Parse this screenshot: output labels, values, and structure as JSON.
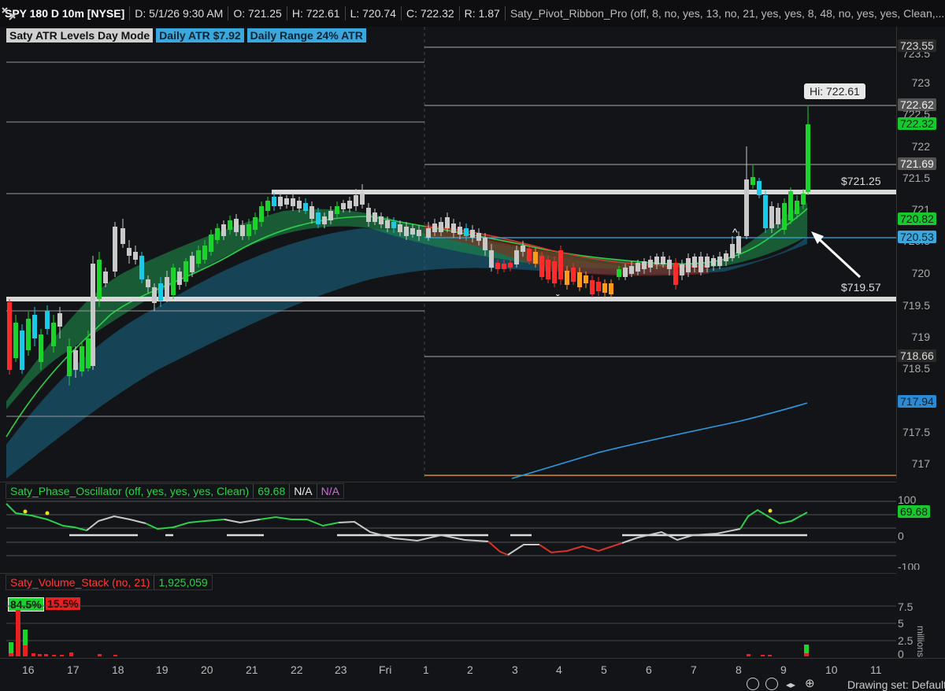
{
  "header": {
    "symbol": "SPY 180 D 10m [NYSE]",
    "date": "D: 5/1/26 9:30 AM",
    "open": "O: 721.25",
    "high": "H: 722.61",
    "low": "L: 720.74",
    "close": "C: 722.32",
    "range": "R: 1.87",
    "study": "Saty_Pivot_Ribbon_Pro (off, 8, no, yes, 13, no, 21, yes, yes, 8, 48, no, yes, yes, Clean,..."
  },
  "study_labels": {
    "atr_levels": "Saty ATR Levels Day Mode",
    "daily_atr": "Daily ATR $7.92",
    "daily_range": "Daily Range 24% ATR"
  },
  "price_axis": [
    "723.5",
    "723",
    "722.5",
    "722",
    "721.5",
    "721",
    "720.5",
    "720",
    "719.5",
    "719",
    "718.5",
    "718",
    "717.5",
    "717"
  ],
  "price_tags": [
    {
      "text": "723.55",
      "bg": "#2a2a2a",
      "fg": "#ddd"
    },
    {
      "text": "722.62",
      "bg": "#555",
      "fg": "#eee"
    },
    {
      "text": "722.32",
      "bg": "#16c92c",
      "fg": "#042008"
    },
    {
      "text": "721.69",
      "bg": "#555",
      "fg": "#eee"
    },
    {
      "text": "720.82",
      "bg": "#16c92c",
      "fg": "#042008"
    },
    {
      "text": "720.53",
      "bg": "#3aa8dc",
      "fg": "#06202e"
    },
    {
      "text": "718.66",
      "bg": "#2a2a2a",
      "fg": "#ddd"
    },
    {
      "text": "717.94",
      "bg": "#2a8bd4",
      "fg": "#06202e"
    }
  ],
  "annotations": {
    "hi_label": "Hi: 722.61",
    "level_upper": "$721.25",
    "level_lower": "$719.57"
  },
  "oscillator": {
    "name": "Saty_Phase_Oscillator (off, yes, yes, yes, Clean)",
    "value": "69.68",
    "na1": "N/A",
    "na2": "N/A",
    "axis_top": "100",
    "axis_mid": "0",
    "axis_bottom": "-100",
    "tag": "69.68"
  },
  "volume": {
    "name": "Saty_Volume_Stack (no, 21)",
    "value": "1,925,059",
    "buy_pct": "84.5%",
    "sell_pct": "15.5%",
    "axis": [
      "7.5",
      "5",
      "2.5",
      "0"
    ],
    "unit": "millions"
  },
  "time_axis": [
    "16",
    "17",
    "18",
    "19",
    "20",
    "21",
    "22",
    "23",
    "Fri",
    "1",
    "2",
    "3",
    "4",
    "5",
    "6",
    "7",
    "8",
    "9",
    "10",
    "11"
  ],
  "footer": {
    "drawing_set": "Drawing set: Default"
  },
  "colors": {
    "bull": "#1bd32a",
    "bear": "#ff2a2a",
    "neutral": "#c8c8c8",
    "teal": "#19c9e6",
    "accent": "#3aa8dc"
  }
}
